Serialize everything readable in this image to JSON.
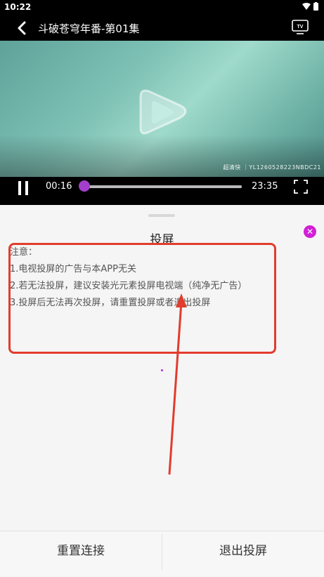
{
  "status_bar": {
    "time": "10:22"
  },
  "header": {
    "title": "斗破苍穹年番-第01集",
    "tv_icon_label": "TV"
  },
  "video": {
    "watermark": "超清快 ｜YL1260528223NBDC21"
  },
  "player": {
    "current_time": "00:16",
    "duration": "23:35",
    "progress": 0.011
  },
  "cast_panel": {
    "title": "投屏",
    "notes": [
      "注意：",
      "1.电视投屏的广告与本APP无关",
      "2.若无法投屏，建议安装光元素投屏电视端（纯净无广告）",
      "3.投屏后无法再次投屏，请重置投屏或者退出投屏"
    ]
  },
  "actions": {
    "reset": "重置连接",
    "exit": "退出投屏"
  },
  "colors": {
    "accent": "#a33fcc",
    "close": "#d21fd6",
    "annotation": "#e23c2e"
  }
}
